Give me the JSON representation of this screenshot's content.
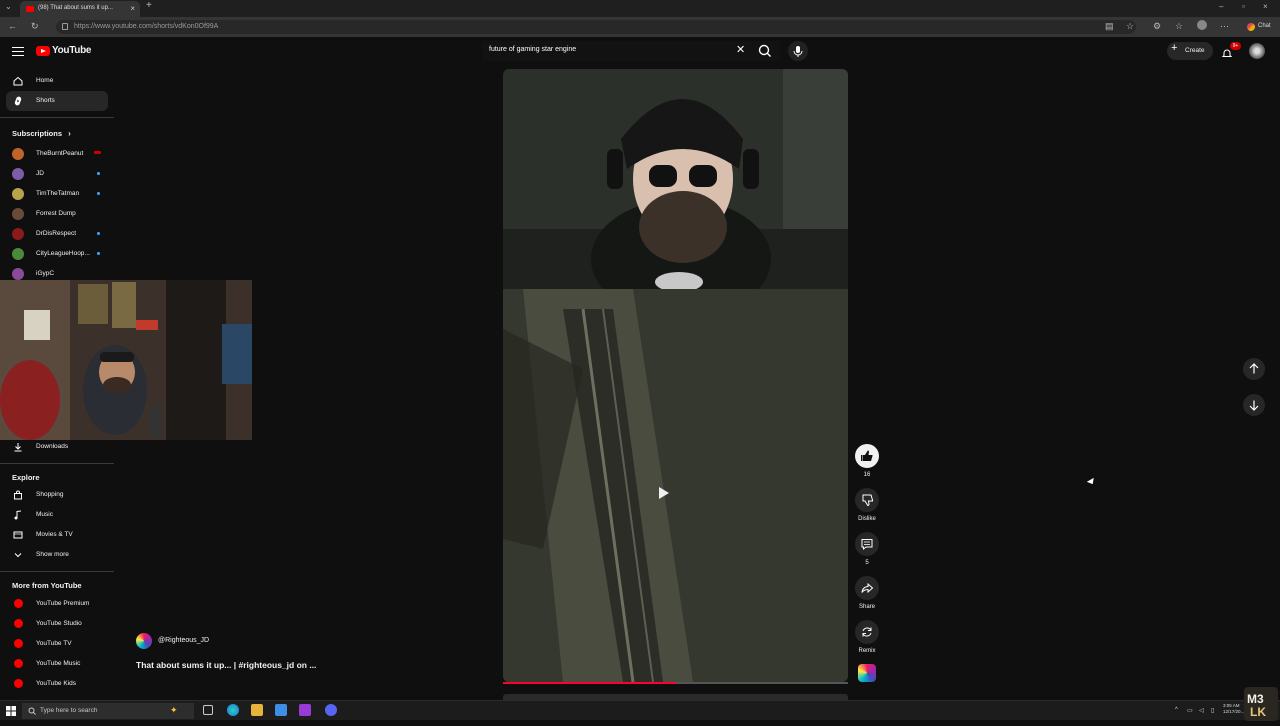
{
  "browser": {
    "tab_title": "(98) That about sums it up...",
    "url": "https://www.youtube.com/shorts/vdKon0Of99A",
    "chat_label": "Chat"
  },
  "header": {
    "logo_text": "YouTube",
    "search_value": "future of gaming star engine",
    "create_label": "Create",
    "notification_count": "9+"
  },
  "sidebar": {
    "nav": [
      {
        "label": "Home",
        "icon": "home-icon"
      },
      {
        "label": "Shorts",
        "icon": "shorts-icon"
      }
    ],
    "subscriptions_heading": "Subscriptions",
    "subscriptions": [
      {
        "name": "TheBurntPeanut",
        "status": "live",
        "color": "#c0642a"
      },
      {
        "name": "JD",
        "status": "new",
        "color": "#7b5ea7"
      },
      {
        "name": "TimTheTatman",
        "status": "new",
        "color": "#b8a34a"
      },
      {
        "name": "Forrest Dump",
        "status": "none",
        "color": "#6a4b3a"
      },
      {
        "name": "DrDisRespect",
        "status": "new",
        "color": "#8b1a1a"
      },
      {
        "name": "CityLeagueHoop...",
        "status": "new",
        "color": "#4a8a3a"
      },
      {
        "name": "iGypC",
        "status": "none",
        "color": "#8a4a9a"
      }
    ],
    "downloads_label": "Downloads",
    "explore_heading": "Explore",
    "explore": [
      {
        "label": "Shopping",
        "icon": "shopping-bag-icon"
      },
      {
        "label": "Music",
        "icon": "music-note-icon"
      },
      {
        "label": "Movies & TV",
        "icon": "film-icon"
      },
      {
        "label": "Show more",
        "icon": "chevron-down-icon"
      }
    ],
    "more_heading": "More from YouTube",
    "more": [
      {
        "label": "YouTube Premium"
      },
      {
        "label": "YouTube Studio"
      },
      {
        "label": "YouTube TV"
      },
      {
        "label": "YouTube Music"
      },
      {
        "label": "YouTube Kids"
      }
    ]
  },
  "short": {
    "channel": "@Righteous_JD",
    "title": "That about sums it up... | #righteous_jd on ...",
    "like_count": "16",
    "dislike_label": "Dislike",
    "comment_count": "5",
    "share_label": "Share",
    "remix_label": "Remix",
    "progress": 0.5
  },
  "taskbar": {
    "search_placeholder": "Type here to search",
    "time": "3:05 AM",
    "date": "12/17/20..."
  },
  "colors": {
    "accent": "#ff0000",
    "progress": "#ff0033",
    "background": "#0f0f0f"
  }
}
